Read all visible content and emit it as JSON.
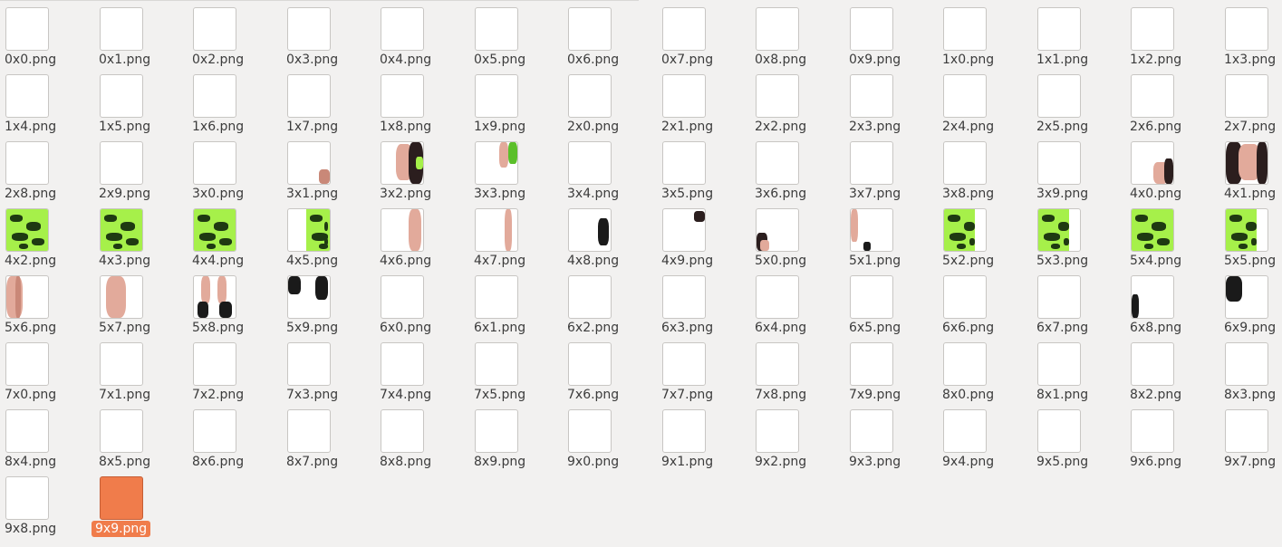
{
  "files": [
    {
      "name": "0x0.png"
    },
    {
      "name": "0x1.png"
    },
    {
      "name": "0x2.png"
    },
    {
      "name": "0x3.png"
    },
    {
      "name": "0x4.png"
    },
    {
      "name": "0x5.png"
    },
    {
      "name": "0x6.png"
    },
    {
      "name": "0x7.png"
    },
    {
      "name": "0x8.png"
    },
    {
      "name": "0x9.png"
    },
    {
      "name": "1x0.png"
    },
    {
      "name": "1x1.png"
    },
    {
      "name": "1x2.png"
    },
    {
      "name": "1x3.png"
    },
    {
      "name": "1x4.png"
    },
    {
      "name": "1x5.png"
    },
    {
      "name": "1x6.png"
    },
    {
      "name": "1x7.png"
    },
    {
      "name": "1x8.png"
    },
    {
      "name": "1x9.png"
    },
    {
      "name": "2x0.png"
    },
    {
      "name": "2x1.png"
    },
    {
      "name": "2x2.png"
    },
    {
      "name": "2x3.png"
    },
    {
      "name": "2x4.png"
    },
    {
      "name": "2x5.png"
    },
    {
      "name": "2x6.png"
    },
    {
      "name": "2x7.png"
    },
    {
      "name": "2x8.png"
    },
    {
      "name": "2x9.png"
    },
    {
      "name": "3x0.png"
    },
    {
      "name": "3x1.png"
    },
    {
      "name": "3x2.png"
    },
    {
      "name": "3x3.png"
    },
    {
      "name": "3x4.png"
    },
    {
      "name": "3x5.png"
    },
    {
      "name": "3x6.png"
    },
    {
      "name": "3x7.png"
    },
    {
      "name": "3x8.png"
    },
    {
      "name": "3x9.png"
    },
    {
      "name": "4x0.png"
    },
    {
      "name": "4x1.png"
    },
    {
      "name": "4x2.png"
    },
    {
      "name": "4x3.png"
    },
    {
      "name": "4x4.png"
    },
    {
      "name": "4x5.png"
    },
    {
      "name": "4x6.png"
    },
    {
      "name": "4x7.png"
    },
    {
      "name": "4x8.png"
    },
    {
      "name": "4x9.png"
    },
    {
      "name": "5x0.png"
    },
    {
      "name": "5x1.png"
    },
    {
      "name": "5x2.png"
    },
    {
      "name": "5x3.png"
    },
    {
      "name": "5x4.png"
    },
    {
      "name": "5x5.png"
    },
    {
      "name": "5x6.png"
    },
    {
      "name": "5x7.png"
    },
    {
      "name": "5x8.png"
    },
    {
      "name": "5x9.png"
    },
    {
      "name": "6x0.png"
    },
    {
      "name": "6x1.png"
    },
    {
      "name": "6x2.png"
    },
    {
      "name": "6x3.png"
    },
    {
      "name": "6x4.png"
    },
    {
      "name": "6x5.png"
    },
    {
      "name": "6x6.png"
    },
    {
      "name": "6x7.png"
    },
    {
      "name": "6x8.png"
    },
    {
      "name": "6x9.png"
    },
    {
      "name": "7x0.png"
    },
    {
      "name": "7x1.png"
    },
    {
      "name": "7x2.png"
    },
    {
      "name": "7x3.png"
    },
    {
      "name": "7x4.png"
    },
    {
      "name": "7x5.png"
    },
    {
      "name": "7x6.png"
    },
    {
      "name": "7x7.png"
    },
    {
      "name": "7x8.png"
    },
    {
      "name": "7x9.png"
    },
    {
      "name": "8x0.png"
    },
    {
      "name": "8x1.png"
    },
    {
      "name": "8x2.png"
    },
    {
      "name": "8x3.png"
    },
    {
      "name": "8x4.png"
    },
    {
      "name": "8x5.png"
    },
    {
      "name": "8x6.png"
    },
    {
      "name": "8x7.png"
    },
    {
      "name": "8x8.png"
    },
    {
      "name": "8x9.png"
    },
    {
      "name": "9x0.png"
    },
    {
      "name": "9x1.png"
    },
    {
      "name": "9x2.png"
    },
    {
      "name": "9x3.png"
    },
    {
      "name": "9x4.png"
    },
    {
      "name": "9x5.png"
    },
    {
      "name": "9x6.png"
    },
    {
      "name": "9x7.png"
    },
    {
      "name": "9x8.png"
    },
    {
      "name": "9x9.png",
      "selected": true
    }
  ],
  "colors": {
    "background": "#f2f1f0",
    "selection": "#f07c4b",
    "label_text": "#3c3c3c"
  }
}
